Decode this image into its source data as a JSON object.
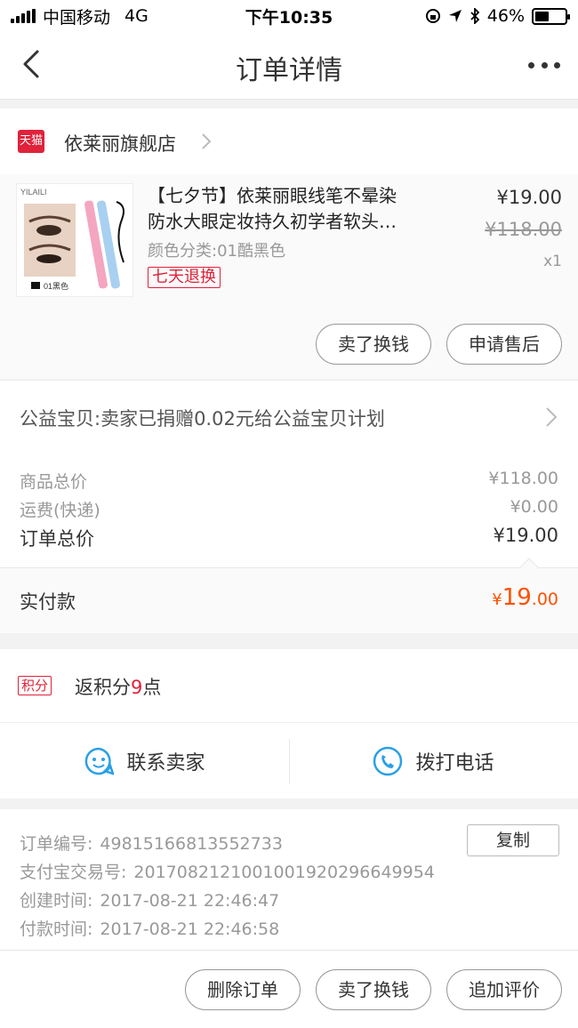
{
  "status_bar": {
    "carrier": "中国移动",
    "network": "4G",
    "time": "下午10:35",
    "battery": "46%",
    "battery_level": 0.46
  },
  "nav": {
    "title": "订单详情",
    "back_icon": "chevron-left-icon",
    "more_icon": "more-dots-icon"
  },
  "shop": {
    "badge": "天猫",
    "name": "依莱丽旗舰店"
  },
  "product": {
    "title_line1": "【七夕节】依莱丽眼线笔不晕染",
    "title_line2": "防水大眼定妆持久初学者软头…",
    "spec": "颜色分类:01酷黑色",
    "tag": "七天退换",
    "price": "¥19.00",
    "original_price": "¥118.00",
    "quantity": "x1",
    "thumb_brand": "YILAILI",
    "thumb_caption": "01黑色"
  },
  "item_actions": {
    "sell_label": "卖了换钱",
    "after_sale_label": "申请售后"
  },
  "charity": {
    "text": "公益宝贝:卖家已捐赠0.02元给公益宝贝计划"
  },
  "totals": {
    "goods_label": "商品总价",
    "goods_value": "¥118.00",
    "shipping_label": "运费(快递)",
    "shipping_value": "¥0.00",
    "order_label": "订单总价",
    "order_value": "¥19.00"
  },
  "paid": {
    "label": "实付款",
    "currency": "¥",
    "integer": "19",
    "decimal": ".00"
  },
  "points": {
    "badge": "积分",
    "prefix": "返积分",
    "value": "9",
    "suffix": "点"
  },
  "contact": {
    "seller_label": "联系卖家",
    "phone_label": "拨打电话"
  },
  "order_info": {
    "order_no_label": "订单编号:",
    "order_no": "49815166813552733",
    "copy_label": "复制",
    "alipay_label": "支付宝交易号:",
    "alipay_no": "2017082121001001920296649954",
    "created_label": "创建时间:",
    "created": "2017-08-21 22:46:47",
    "paid_label": "付款时间:",
    "paid": "2017-08-21 22:46:58"
  },
  "bottom_bar": {
    "delete_label": "删除订单",
    "sell_label": "卖了换钱",
    "review_label": "追加评价"
  },
  "colors": {
    "tmall_red": "#e0223a",
    "price_orange": "#ff5000",
    "contact_blue": "#2aa0e6"
  }
}
